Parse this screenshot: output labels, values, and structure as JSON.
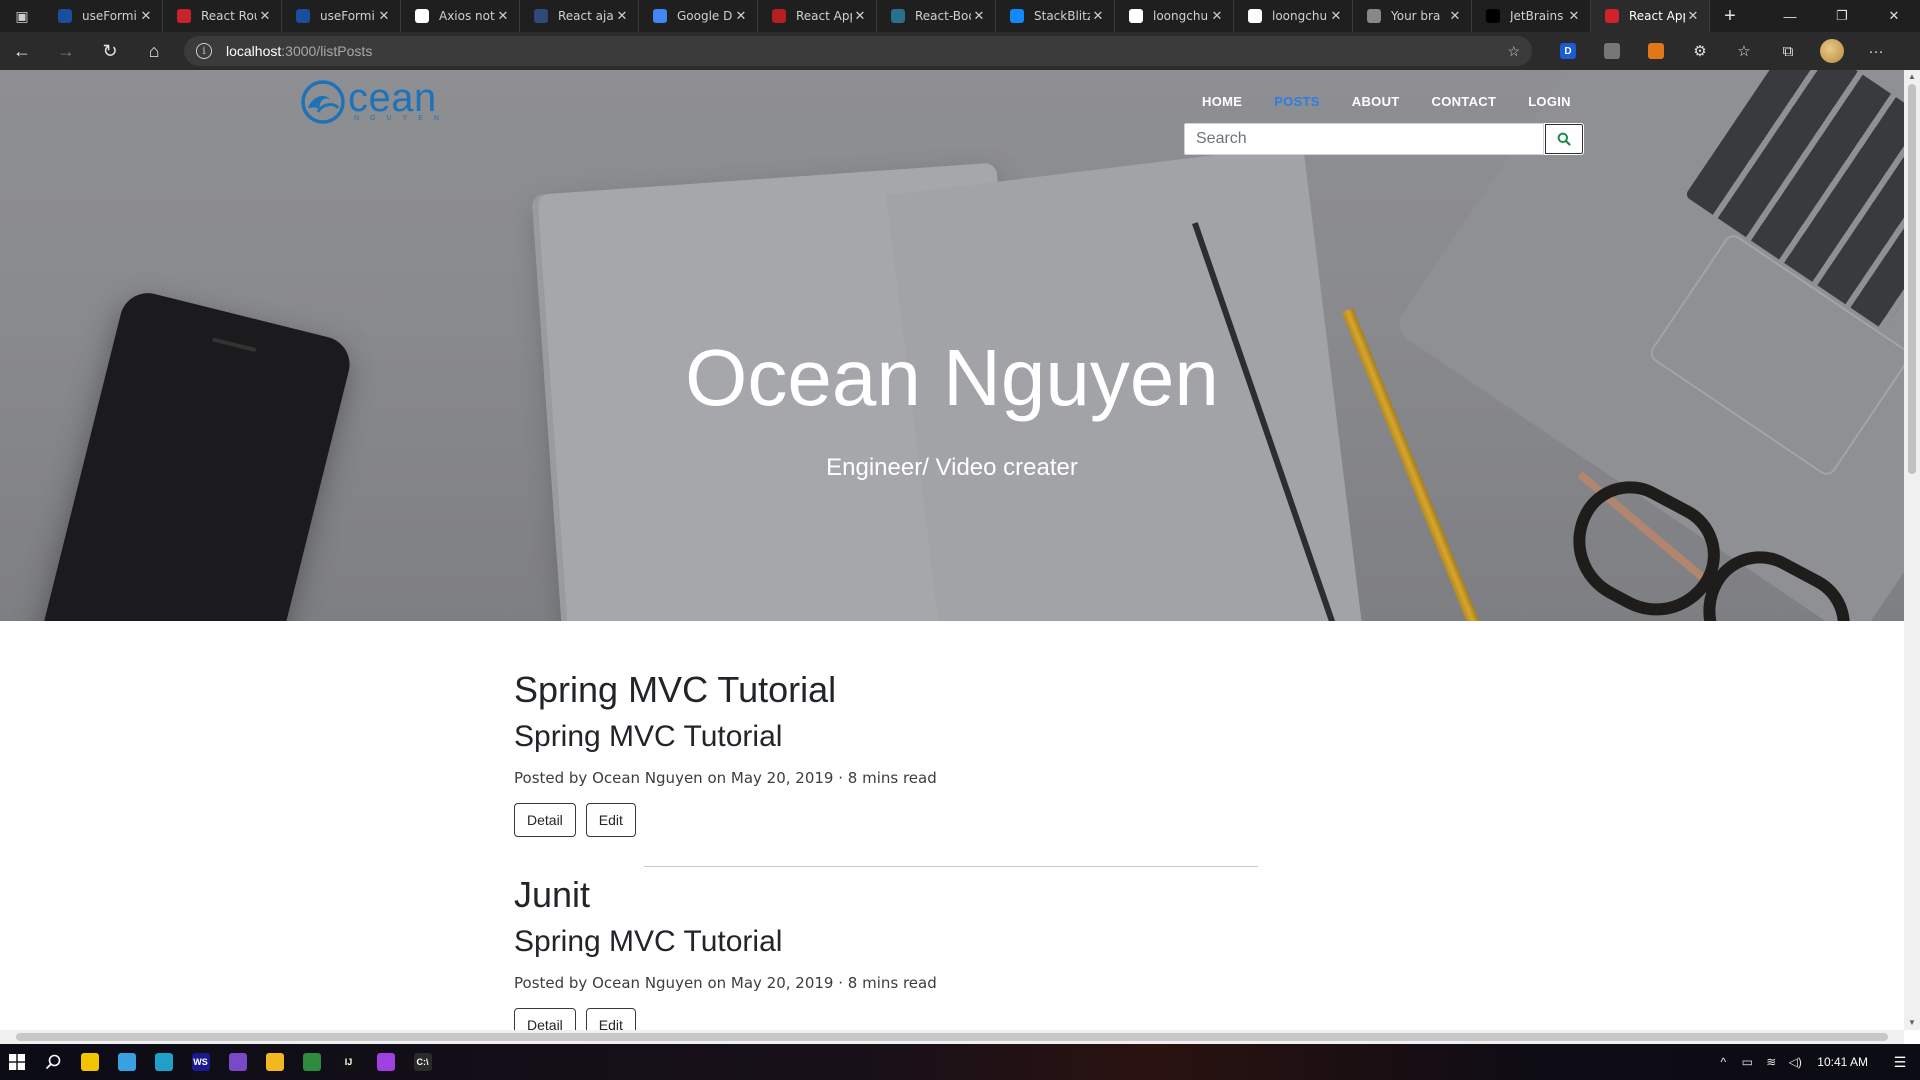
{
  "browser": {
    "tabs": [
      {
        "title": "useFormi",
        "favicon_color": "#1a4fa0",
        "active": false
      },
      {
        "title": "React Rou",
        "favicon_color": "#c8232c",
        "active": false
      },
      {
        "title": "useFormi",
        "favicon_color": "#1a4fa0",
        "active": false
      },
      {
        "title": "Axios not",
        "favicon_color": "#ffffff",
        "active": false
      },
      {
        "title": "React aja",
        "favicon_color": "#2f4a7a",
        "active": false
      },
      {
        "title": "Google D",
        "favicon_color": "#4285f4",
        "active": false
      },
      {
        "title": "React App",
        "favicon_color": "#b51f1f",
        "active": false
      },
      {
        "title": "React-Boo",
        "favicon_color": "#2a6f8f",
        "active": false
      },
      {
        "title": "StackBlitz",
        "favicon_color": "#1389fd",
        "active": false
      },
      {
        "title": "loongchu",
        "favicon_color": "#ffffff",
        "active": false
      },
      {
        "title": "loongchu",
        "favicon_color": "#ffffff",
        "active": false
      },
      {
        "title": "Your bra",
        "favicon_color": "#888888",
        "active": false
      },
      {
        "title": "JetBrains",
        "favicon_color": "#000000",
        "active": false
      },
      {
        "title": "React App",
        "favicon_color": "#d3202a",
        "active": true
      }
    ],
    "new_tab_symbol": "+",
    "window_controls": {
      "minimize": "—",
      "restore": "❐",
      "close": "✕"
    },
    "address": {
      "host": "localhost",
      "path": ":3000/listPosts"
    },
    "nav": {
      "back": "←",
      "forward": "→",
      "reload": "↻",
      "home": "⌂"
    },
    "extensions": [
      {
        "name": "dashlane-icon",
        "label": "D",
        "color": "#1a5bd6"
      },
      {
        "name": "extension-chip-icon",
        "label": "",
        "color": "#777777"
      },
      {
        "name": "metamask-icon",
        "label": "",
        "color": "#e2761b"
      },
      {
        "name": "puzzle-icon",
        "label": "⚙",
        "color": ""
      },
      {
        "name": "favorites-icon",
        "label": "☆",
        "color": ""
      },
      {
        "name": "collections-icon",
        "label": "⧉",
        "color": ""
      }
    ],
    "more_symbol": "···"
  },
  "site": {
    "logo": {
      "word": "cean",
      "sub": "NGUYEN"
    },
    "nav": [
      {
        "label": "HOME",
        "active": false
      },
      {
        "label": "POSTS",
        "active": true
      },
      {
        "label": "ABOUT",
        "active": false
      },
      {
        "label": "CONTACT",
        "active": false
      },
      {
        "label": "LOGIN",
        "active": false
      }
    ],
    "search": {
      "placeholder": "Search",
      "value": ""
    },
    "hero": {
      "title": "Ocean Nguyen",
      "subtitle": "Engineer/ Video creater"
    },
    "posts": [
      {
        "title": "Spring MVC Tutorial",
        "subtitle": "Spring MVC Tutorial",
        "meta": "Posted by Ocean Nguyen on May 20, 2019 · 8 mins read",
        "actions": [
          "Detail",
          "Edit"
        ]
      },
      {
        "title": "Junit",
        "subtitle": "Spring MVC Tutorial",
        "meta": "Posted by Ocean Nguyen on May 20, 2019 · 8 mins read",
        "actions": [
          "Detail",
          "Edit"
        ]
      }
    ],
    "colors": {
      "accent": "#2a7ee0",
      "logo": "#1e73b8"
    }
  },
  "taskbar": {
    "apps": [
      {
        "name": "start-icon",
        "label": "",
        "color": ""
      },
      {
        "name": "search-icon",
        "label": "",
        "color": ""
      },
      {
        "name": "sticky-notes-icon",
        "label": "",
        "color": "#f5c400"
      },
      {
        "name": "desktop-icon",
        "label": "",
        "color": "#3aa0e0"
      },
      {
        "name": "edge-icon",
        "label": "",
        "color": "#1fa0c8"
      },
      {
        "name": "webstorm-icon",
        "label": "WS",
        "color": "#1a1a8f"
      },
      {
        "name": "github-desktop-icon",
        "label": "",
        "color": "#7b48c8"
      },
      {
        "name": "file-explorer-icon",
        "label": "",
        "color": "#f2b820"
      },
      {
        "name": "idm-icon",
        "label": "",
        "color": "#2e8b3e"
      },
      {
        "name": "intellij-icon",
        "label": "IJ",
        "color": "#111111"
      },
      {
        "name": "messenger-icon",
        "label": "",
        "color": "#a040e0"
      },
      {
        "name": "terminal-icon",
        "label": "C:\\",
        "color": "#2a2a2a"
      }
    ],
    "tray": {
      "chevron": "^",
      "battery": "▭",
      "wifi": "≋",
      "volume": "◁)",
      "time": "10:41 AM",
      "notifications": "☰"
    }
  }
}
